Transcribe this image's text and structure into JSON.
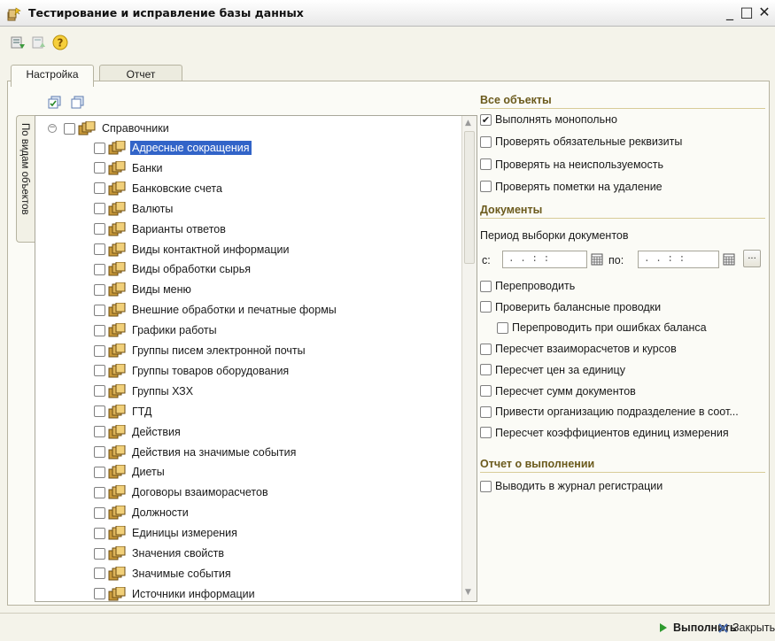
{
  "window": {
    "title": "Тестирование и исправление базы данных",
    "minimize_icon": "minimize-icon",
    "maximize_icon": "maximize-icon",
    "close_icon": "close-icon"
  },
  "toolbar": {
    "buttons": [
      "load-settings-icon",
      "save-settings-icon",
      "help-icon"
    ],
    "help_label": "?"
  },
  "tabs": [
    {
      "label": "Настройка",
      "active": true
    },
    {
      "label": "Отчет",
      "active": false
    }
  ],
  "side_tab": {
    "label": "По видам объектов"
  },
  "tree": {
    "root": {
      "label": "Справочники",
      "checked": false
    },
    "items": [
      {
        "label": "Адресные сокращения",
        "selected": true
      },
      {
        "label": "Банки"
      },
      {
        "label": "Банковские счета"
      },
      {
        "label": "Валюты"
      },
      {
        "label": "Варианты ответов"
      },
      {
        "label": "Виды контактной информации"
      },
      {
        "label": "Виды обработки сырья"
      },
      {
        "label": "Виды меню"
      },
      {
        "label": "Внешние обработки и печатные формы"
      },
      {
        "label": "Графики работы"
      },
      {
        "label": "Группы писем электронной почты"
      },
      {
        "label": "Группы товаров оборудования"
      },
      {
        "label": "Группы ХЗХ"
      },
      {
        "label": "ГТД"
      },
      {
        "label": "Действия"
      },
      {
        "label": "Действия на значимые события"
      },
      {
        "label": "Диеты"
      },
      {
        "label": "Договоры взаиморасчетов"
      },
      {
        "label": "Должности"
      },
      {
        "label": "Единицы измерения"
      },
      {
        "label": "Значения свойств"
      },
      {
        "label": "Значимые события"
      },
      {
        "label": "Источники информации"
      }
    ]
  },
  "all_objects": {
    "title": "Все объекты",
    "options": [
      {
        "label": "Выполнять монопольно",
        "checked": true
      },
      {
        "label": "Проверять обязательные реквизиты",
        "checked": false
      },
      {
        "label": "Проверять на неиспользуемость",
        "checked": false
      },
      {
        "label": "Проверять пометки на удаление",
        "checked": false
      }
    ]
  },
  "documents": {
    "title": "Документы",
    "period_label": "Период выборки документов",
    "from_label": "с:",
    "to_label": "по:",
    "from_value": ". .   : :",
    "to_value": ". .   : :",
    "dots_label": "...",
    "options": [
      {
        "label": "Перепроводить",
        "checked": false
      },
      {
        "label": "Проверить балансные проводки",
        "checked": false
      },
      {
        "label": "Перепроводить при ошибках баланса",
        "checked": false
      },
      {
        "label": "Пересчет взаиморасчетов и курсов",
        "checked": false
      },
      {
        "label": "Пересчет цен за единицу",
        "checked": false
      },
      {
        "label": "Пересчет сумм документов",
        "checked": false
      },
      {
        "label": "Привести организацию подразделение в соот...",
        "checked": false
      },
      {
        "label": "Пересчет коэффициентов единиц измерения",
        "checked": false
      }
    ]
  },
  "report": {
    "title": "Отчет о выполнении",
    "options": [
      {
        "label": "Выводить в журнал регистрации",
        "checked": false
      }
    ]
  },
  "footer": {
    "run_label": "Выполнить",
    "close_label": "Закрыть"
  },
  "colors": {
    "accent": "#3264c8",
    "section_title": "#6b5a1c",
    "run_arrow": "#2e9a2e",
    "close_x": "#4a6aa8"
  }
}
